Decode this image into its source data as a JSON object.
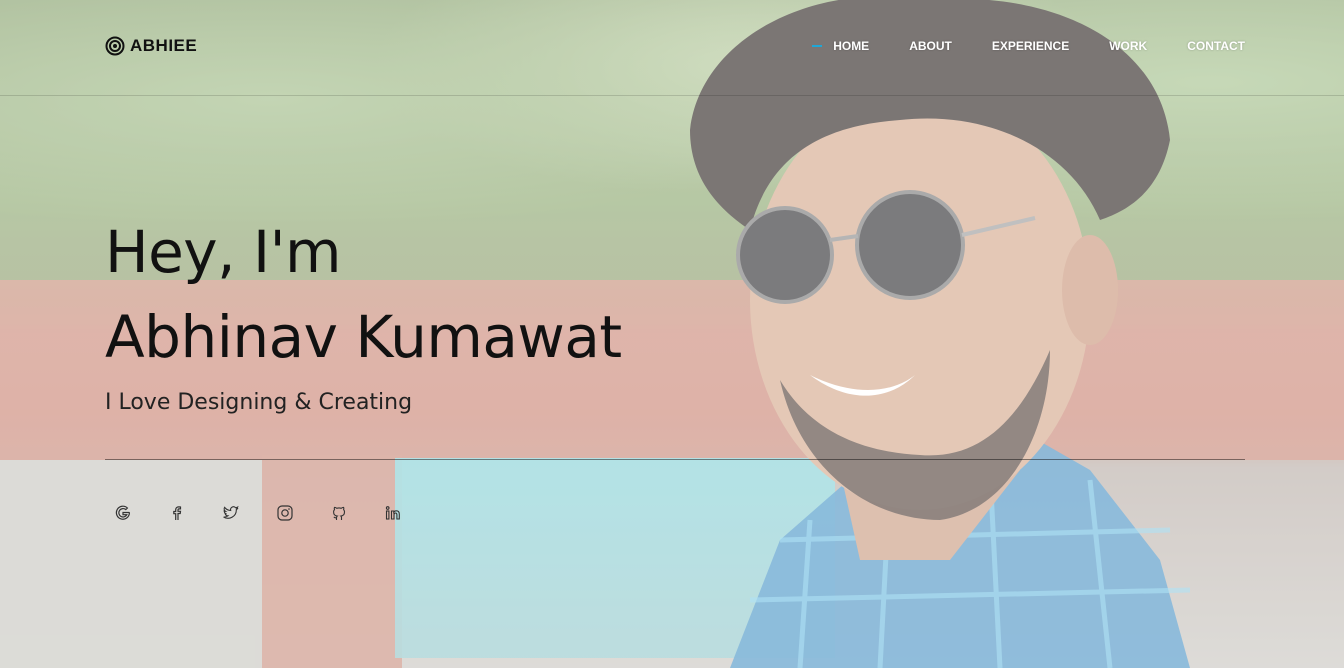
{
  "brand": {
    "name": "ABHIEE"
  },
  "nav": {
    "items": [
      {
        "label": "HOME",
        "active": true
      },
      {
        "label": "ABOUT",
        "active": false
      },
      {
        "label": "EXPERIENCE",
        "active": false
      },
      {
        "label": "WORK",
        "active": false
      },
      {
        "label": "CONTACT",
        "active": false
      }
    ]
  },
  "hero": {
    "greeting": "Hey, I'm",
    "name": "Abhinav Kumawat",
    "tagline": "I Love Designing & Creating"
  },
  "social": [
    "google-icon",
    "facebook-icon",
    "twitter-icon",
    "instagram-icon",
    "github-icon",
    "linkedin-icon"
  ],
  "colors": {
    "accent": "#1fa7d7",
    "text": "#111111",
    "nav_text": "#ffffff"
  }
}
